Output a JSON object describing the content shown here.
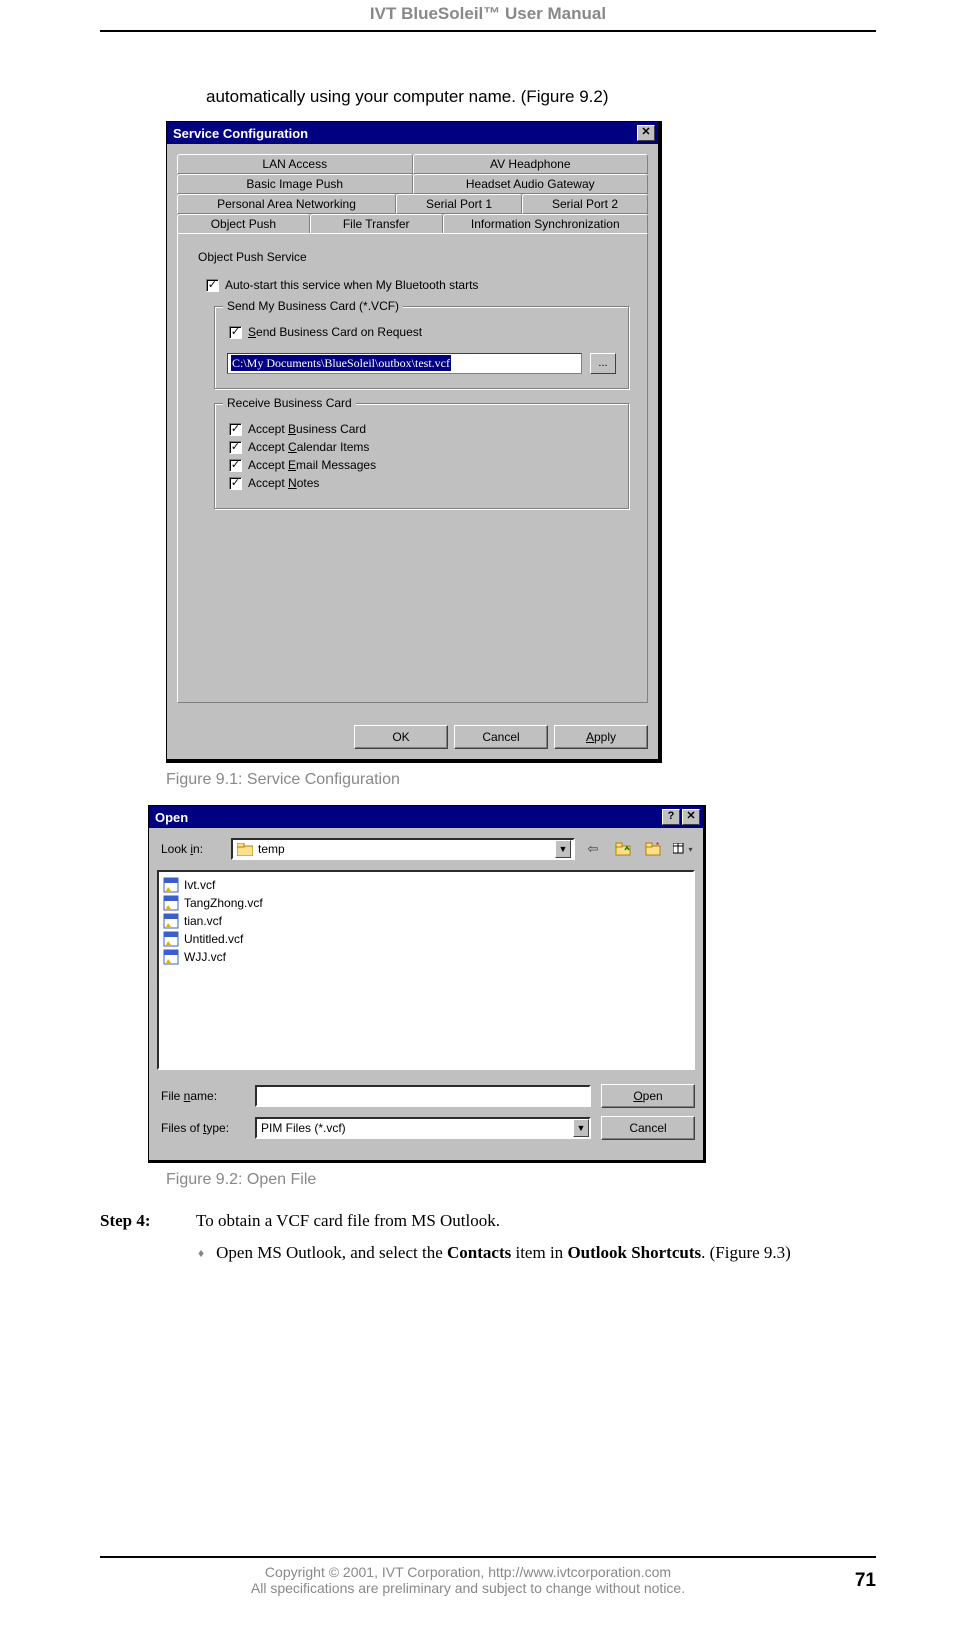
{
  "header": "IVT BlueSoleil™ User Manual",
  "intro": "automatically using your computer name. (Figure 9.2)",
  "sc": {
    "title": "Service Configuration",
    "tabs_row1": [
      "LAN Access",
      "AV Headphone"
    ],
    "tabs_row2": [
      "Basic Image Push",
      "Headset Audio Gateway"
    ],
    "tabs_row3": [
      "Personal Area Networking",
      "Serial Port 1",
      "Serial Port 2"
    ],
    "tabs_row4": [
      "Object Push",
      "File Transfer",
      "Information Synchronization"
    ],
    "group_title": "Object Push Service",
    "autostart": "Auto-start this service when My Bluetooth starts",
    "send_legend": "Send My Business Card (*.VCF)",
    "send_on_request": "Send Business Card on Request",
    "path": "C:\\My Documents\\BlueSoleil\\outbox\\test.vcf",
    "browse": "...",
    "recv_legend": "Receive Business Card",
    "accept_business": "Accept Business Card",
    "accept_calendar": "Accept Calendar Items",
    "accept_email": "Accept Email Messages",
    "accept_notes": "Accept Notes",
    "ok": "OK",
    "cancel": "Cancel",
    "apply": "Apply"
  },
  "caption1": "Figure 9.1: Service Configuration",
  "open": {
    "title": "Open",
    "lookin_lbl": "Look in:",
    "folder": "temp",
    "files": [
      "Ivt.vcf",
      "TangZhong.vcf",
      "tian.vcf",
      "Untitled.vcf",
      "WJJ.vcf"
    ],
    "filename_lbl": "File name:",
    "filename_val": "",
    "filetype_lbl": "Files of type:",
    "filetype_val": "PIM Files (*.vcf)",
    "open_btn": "Open",
    "cancel_btn": "Cancel"
  },
  "caption2": "Figure 9.2: Open File",
  "step4_label": "Step 4:",
  "step4_text": "To obtain a VCF card file from MS Outlook.",
  "bullet1_pre": "Open MS Outlook, and select the ",
  "bullet1_b1": "Contacts",
  "bullet1_mid": " item in ",
  "bullet1_b2": "Outlook Shortcuts",
  "bullet1_post": ". (Figure 9.3)",
  "footer_line1": "Copyright © 2001, IVT Corporation, http://www.ivtcorporation.com",
  "footer_line2": "All specifications are preliminary and subject to change without notice.",
  "page_number": "71"
}
